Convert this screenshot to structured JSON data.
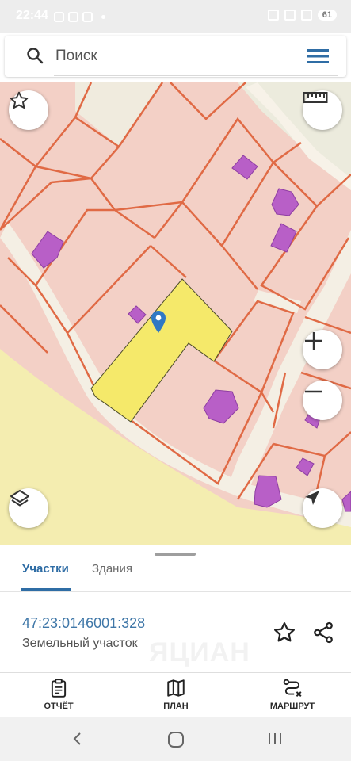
{
  "status_bar": {
    "time": "22:44",
    "battery": "61"
  },
  "search": {
    "placeholder": "Поиск"
  },
  "map": {
    "icons": [
      "star-icon",
      "ruler-icon",
      "layers-icon",
      "zoom-in-icon",
      "zoom-out-icon",
      "navigation-arrow-icon",
      "location-pin-icon"
    ],
    "colors": {
      "parcel_fill": "#f3d0c6",
      "parcel_border": "#e06a45",
      "building": "#b85fc7",
      "selected_parcel": "#f5e96a",
      "road": "#f4efe4",
      "field": "#f4edb0",
      "pin": "#2f78c4"
    }
  },
  "sheet": {
    "tabs": [
      {
        "label": "Участки",
        "active": true
      },
      {
        "label": "Здания",
        "active": false
      }
    ],
    "cadastral_number": "47:23:0146001:328",
    "object_type": "Земельный участок",
    "watermark": "ЯЦИАН",
    "accent_color": "#2f6da5"
  },
  "bottom_nav": {
    "items": [
      {
        "label": "ОТЧЁТ",
        "icon": "report-clipboard-icon"
      },
      {
        "label": "ПЛАН",
        "icon": "map-plan-icon"
      },
      {
        "label": "МАРШРУТ",
        "icon": "route-icon"
      }
    ]
  },
  "system_nav": {
    "icons": [
      "back-icon",
      "home-icon",
      "recent-apps-icon"
    ]
  }
}
